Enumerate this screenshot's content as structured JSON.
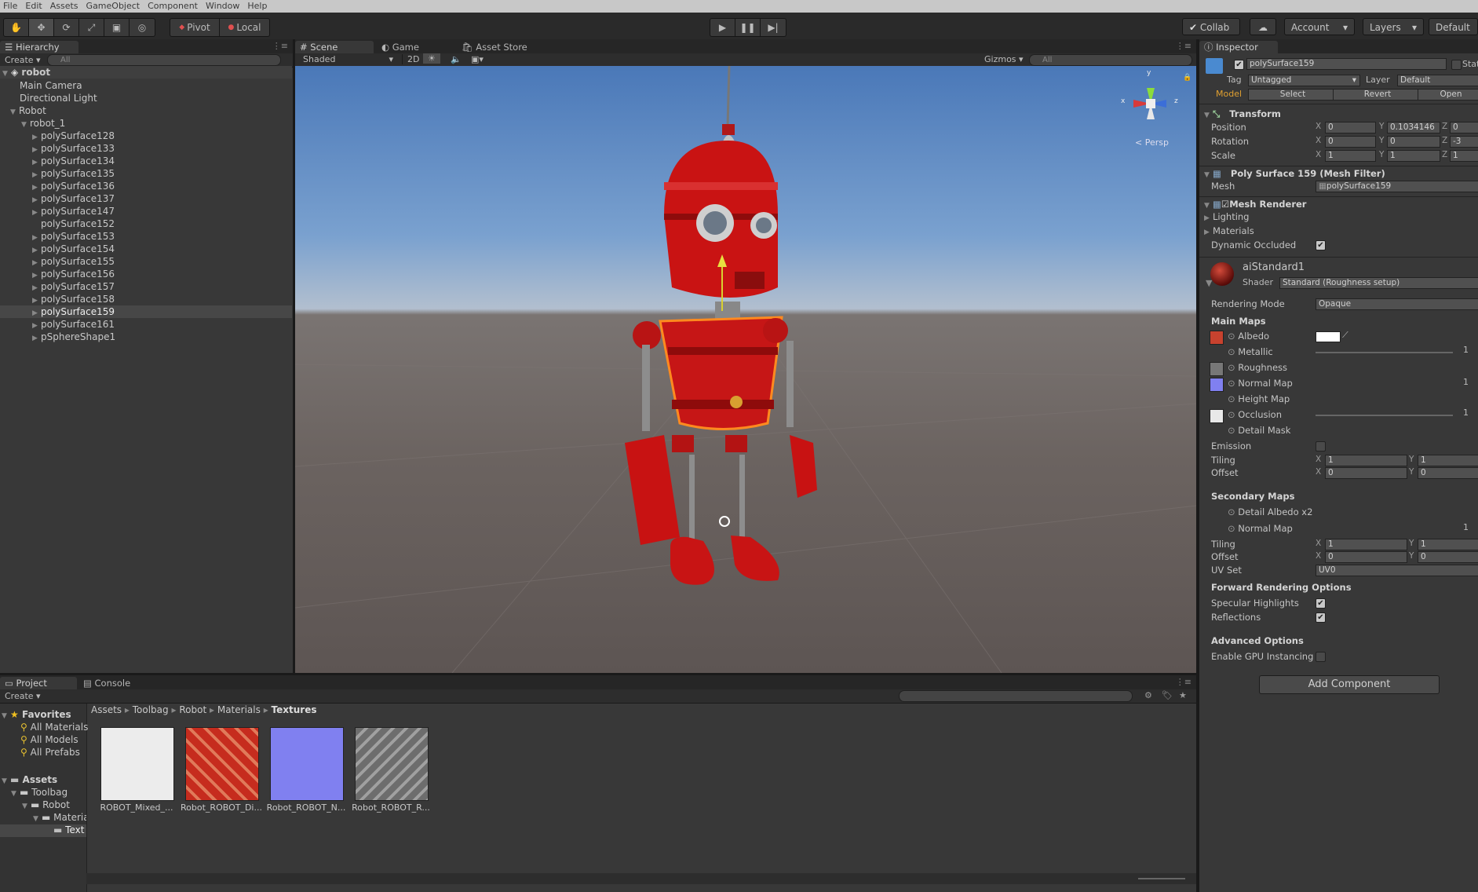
{
  "menu": [
    "File",
    "Edit",
    "Assets",
    "GameObject",
    "Component",
    "Window",
    "Help"
  ],
  "toolbar": {
    "pivot": "Pivot",
    "local": "Local",
    "collab": "Collab",
    "account": "Account",
    "layers": "Layers",
    "layout": "Default"
  },
  "hierarchy": {
    "tab": "Hierarchy",
    "create": "Create",
    "search": "All",
    "scene_name": "robot",
    "items": [
      {
        "label": "Main Camera"
      },
      {
        "label": "Directional Light"
      },
      {
        "label": "Robot"
      },
      {
        "label": "robot_1"
      },
      {
        "label": "polySurface128"
      },
      {
        "label": "polySurface133"
      },
      {
        "label": "polySurface134"
      },
      {
        "label": "polySurface135"
      },
      {
        "label": "polySurface136"
      },
      {
        "label": "polySurface137"
      },
      {
        "label": "polySurface147"
      },
      {
        "label": "polySurface152"
      },
      {
        "label": "polySurface153"
      },
      {
        "label": "polySurface154"
      },
      {
        "label": "polySurface155"
      },
      {
        "label": "polySurface156"
      },
      {
        "label": "polySurface157"
      },
      {
        "label": "polySurface158"
      },
      {
        "label": "polySurface159"
      },
      {
        "label": "polySurface161"
      },
      {
        "label": "pSphereShape1"
      }
    ]
  },
  "scene": {
    "tabs": [
      "Scene",
      "Game",
      "Asset Store"
    ],
    "shading": "Shaded",
    "mode2d": "2D",
    "gizmos": "Gizmos",
    "search": "All",
    "persp": "Persp",
    "axis_x": "x",
    "axis_y": "y",
    "axis_z": "z"
  },
  "project": {
    "tabs": [
      "Project",
      "Console"
    ],
    "create": "Create",
    "favorites": "Favorites",
    "fav_items": [
      "All Materials",
      "All Models",
      "All Prefabs"
    ],
    "assets": "Assets",
    "tree": [
      "Toolbag",
      "Robot",
      "Materia",
      "Text"
    ],
    "breadcrumb": [
      "Assets",
      "Toolbag",
      "Robot",
      "Materials",
      "Textures"
    ],
    "files": [
      {
        "name": "ROBOT_Mixed_...",
        "color": "#e6e6e6"
      },
      {
        "name": "Robot_ROBOT_Di...",
        "color": "#c6301f"
      },
      {
        "name": "Robot_ROBOT_N...",
        "color": "#7f80f2"
      },
      {
        "name": "Robot_ROBOT_R...",
        "color": "#8b8b8b"
      }
    ]
  },
  "inspector": {
    "tab": "Inspector",
    "object_name": "polySurface159",
    "static": "Stat",
    "tag_label": "Tag",
    "tag_value": "Untagged",
    "layer_label": "Layer",
    "layer_value": "Default",
    "model_label": "Model",
    "select": "Select",
    "revert": "Revert",
    "open": "Open",
    "transform": "Transform",
    "position_label": "Position",
    "pos_x": "0",
    "pos_y": "0.1034146",
    "pos_z": "0",
    "rotation_label": "Rotation",
    "rot_x": "0",
    "rot_y": "0",
    "rot_z": "-3",
    "scale_label": "Scale",
    "scl_x": "1",
    "scl_y": "1",
    "scl_z": "1",
    "mesh_filter": "Poly Surface 159 (Mesh Filter)",
    "mesh_label": "Mesh",
    "mesh_value": "polySurface159",
    "mesh_renderer": "Mesh Renderer",
    "lighting": "Lighting",
    "materials": "Materials",
    "dynamic_occluded": "Dynamic Occluded",
    "material_name": "aiStandard1",
    "shader_label": "Shader",
    "shader_value": "Standard (Roughness setup)",
    "rendering_mode_label": "Rendering Mode",
    "rendering_mode": "Opaque",
    "main_maps": "Main Maps",
    "albedo": "Albedo",
    "metallic": "Metallic",
    "metallic_value": "1",
    "roughness": "Roughness",
    "normal_map": "Normal Map",
    "normal_value": "1",
    "height_map": "Height Map",
    "occlusion": "Occlusion",
    "occlusion_value": "1",
    "detail_mask": "Detail Mask",
    "emission": "Emission",
    "tiling": "Tiling",
    "tiling_x": "1",
    "tiling_y": "1",
    "offset": "Offset",
    "offset_x": "0",
    "offset_y": "0",
    "secondary_maps": "Secondary Maps",
    "detail_albedo": "Detail Albedo x2",
    "normal_map2": "Normal Map",
    "normal2_value": "1",
    "tiling2_x": "1",
    "tiling2_y": "1",
    "offset2_x": "0",
    "offset2_y": "0",
    "uv_set": "UV Set",
    "uv_value": "UV0",
    "forward": "Forward Rendering Options",
    "specular": "Specular Highlights",
    "reflections": "Reflections",
    "advanced": "Advanced Options",
    "gpu": "Enable GPU Instancing",
    "add_component": "Add Component",
    "x": "X",
    "y": "Y",
    "z": "Z"
  },
  "colors": {
    "accent": "#3d6fb6",
    "robot_red": "#c81010",
    "bg_panel": "#383838"
  }
}
